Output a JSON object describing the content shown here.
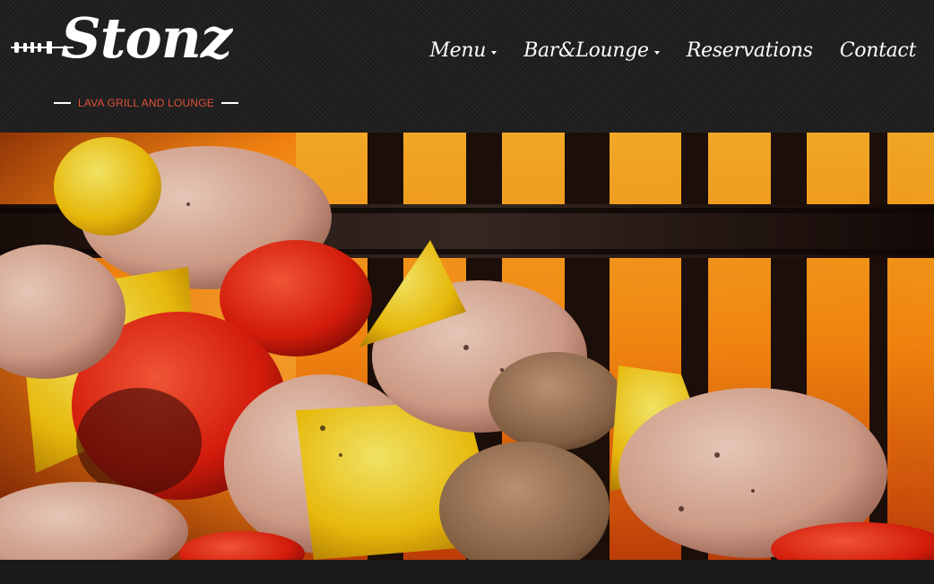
{
  "brand": {
    "name": "Stonz",
    "tagline": "LAVA GRILL AND LOUNGE",
    "tagline_color": "#e2503a",
    "logo_icon": "skewer-icon"
  },
  "nav": {
    "items": [
      {
        "label": "Menu",
        "has_dropdown": true
      },
      {
        "label": "Bar&Lounge",
        "has_dropdown": true
      },
      {
        "label": "Reservations",
        "has_dropdown": false
      },
      {
        "label": "Contact",
        "has_dropdown": false
      }
    ],
    "dropdown_icon": "caret-down-icon"
  },
  "hero": {
    "image_subject": "grilled meat and vegetable skewers over flaming grill grate"
  },
  "colors": {
    "header_bg": "#1c1c1c",
    "nav_text": "#ffffff",
    "accent": "#e2503a"
  }
}
